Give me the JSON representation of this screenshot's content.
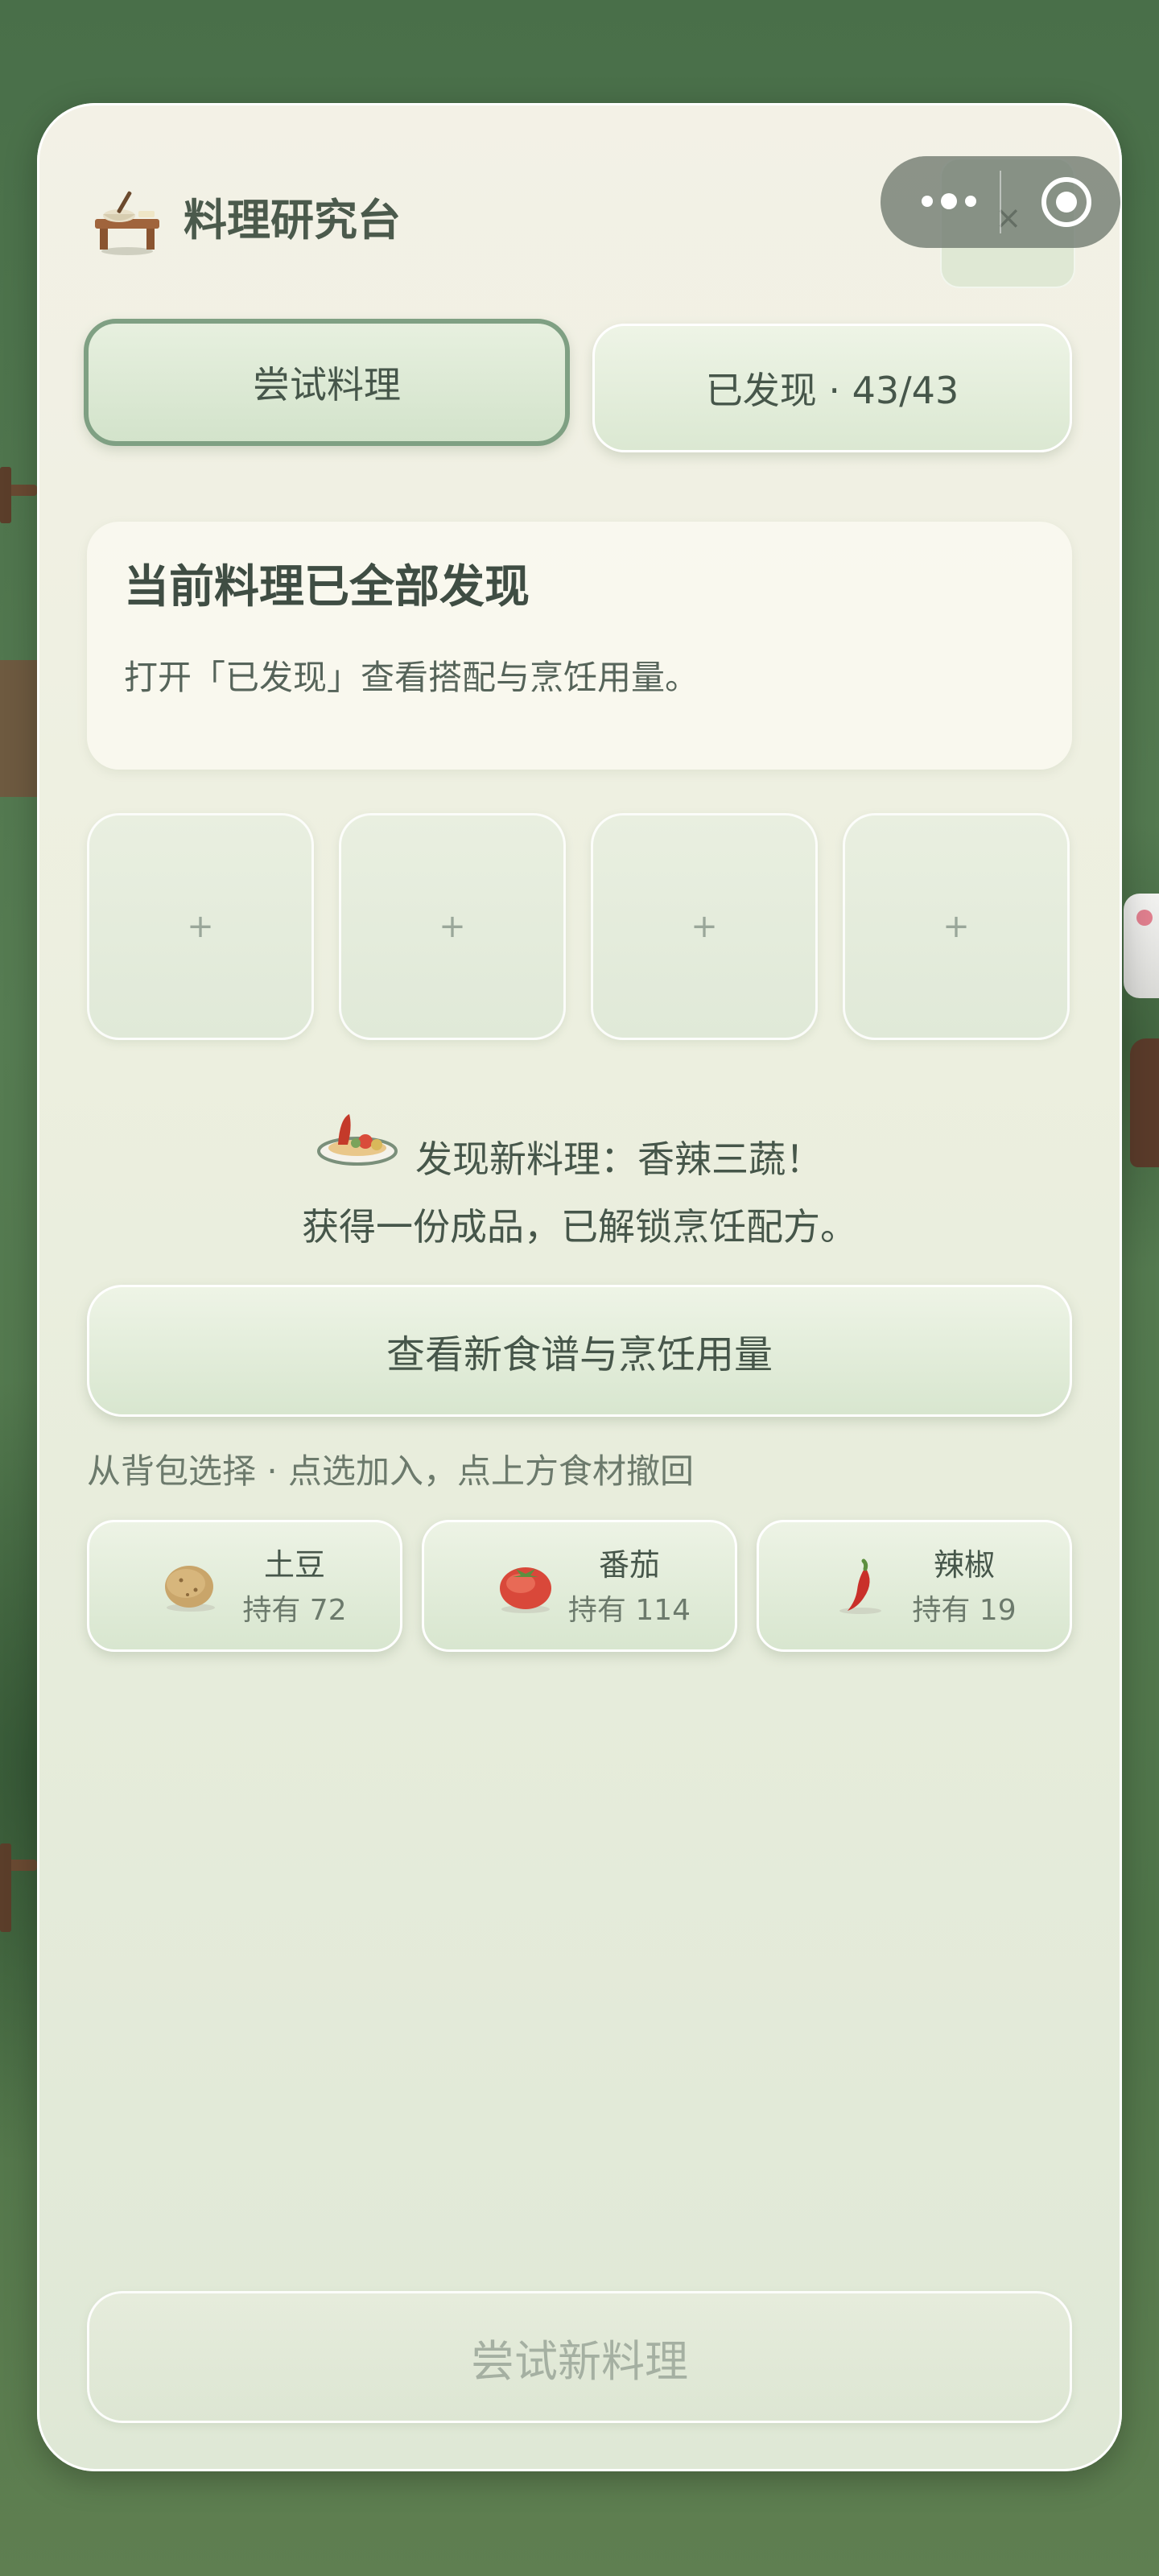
{
  "header": {
    "title": "料理研究台"
  },
  "tabs": [
    {
      "label": "尝试料理"
    },
    {
      "label": "已发现 · 43/43"
    }
  ],
  "status": {
    "title": "当前料理已全部发现",
    "desc": "打开「已发现」查看搭配与烹饪用量。"
  },
  "slots": [
    "+",
    "+",
    "+",
    "+"
  ],
  "discovery": {
    "line1": "发现新料理：香辣三蔬！",
    "line2": "获得一份成品，已解锁烹饪配方。"
  },
  "view_button": "查看新食谱与烹饪用量",
  "hint": "从背包选择 · 点选加入，点上方食材撤回",
  "inventory": [
    {
      "name": "土豆",
      "count": "持有 72",
      "icon": "potato-icon"
    },
    {
      "name": "番茄",
      "count": "持有 114",
      "icon": "tomato-icon"
    },
    {
      "name": "辣椒",
      "count": "持有 19",
      "icon": "chili-icon"
    }
  ],
  "close_glyph": "×",
  "try_button": "尝试新料理"
}
